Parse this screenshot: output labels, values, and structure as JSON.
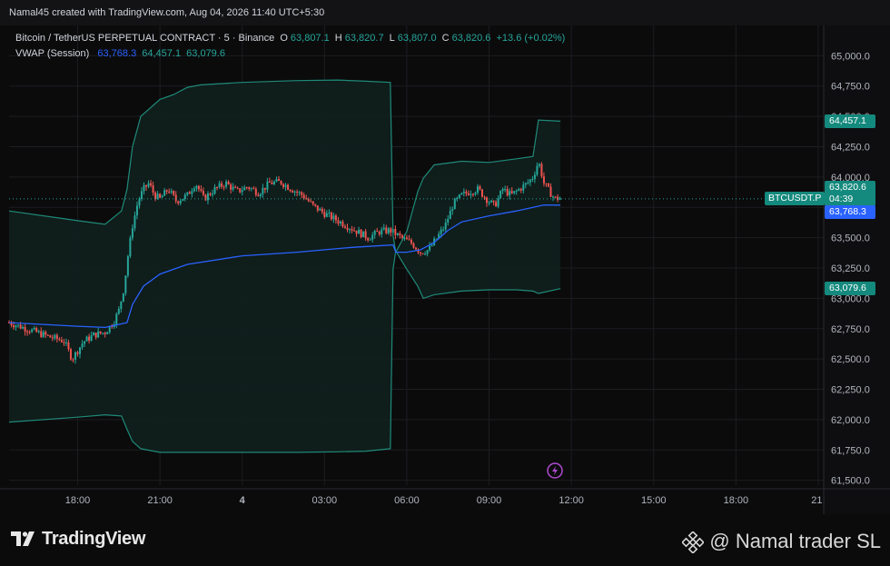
{
  "credit": "Namal45 created with TradingView.com, Aug 04, 2026 11:40 UTC+5:30",
  "legend": {
    "symbol": "Bitcoin / TetherUS PERPETUAL CONTRACT · 5 · Binance",
    "o_label": "O",
    "o_value": "63,807.1",
    "h_label": "H",
    "h_value": "63,820.7",
    "l_label": "L",
    "l_value": "63,807.0",
    "c_label": "C",
    "c_value": "63,820.6",
    "change": "+13.6 (+0.02%)",
    "vwap_label": "VWAP (Session)",
    "vwap_value": "63,768.3",
    "upper_value": "64,457.1",
    "lower_value": "63,079.6"
  },
  "tags": {
    "symbol": "BTCUSDT.P",
    "price": "63,820.6",
    "countdown": "04:39",
    "vwap": "63,768.3",
    "upper": "64,457.1",
    "lower": "63,079.6"
  },
  "colors": {
    "up": "#26a69a",
    "down": "#ef5350",
    "vwap": "#2962ff",
    "band": "#1f8a78",
    "band_fill": "#0f1f1d",
    "tag_green": "#14897d",
    "tag_blue": "#2962ff"
  },
  "branding": {
    "logo_text": "TradingView",
    "watermark": "@ Namal trader SL"
  },
  "chart_data": {
    "type": "line",
    "title": "Bitcoin / TetherUS PERPETUAL CONTRACT · 5 · Binance",
    "xlabel": "",
    "ylabel": "",
    "ylim": [
      61400,
      65100
    ],
    "grid": true,
    "y_ticks": [
      "61,500.0",
      "61,750.0",
      "62,000.0",
      "62,250.0",
      "62,500.0",
      "62,750.0",
      "63,000.0",
      "63,250.0",
      "63,500.0",
      "63,750.0",
      "64,000.0",
      "64,250.0",
      "64,500.0",
      "64,750.0",
      "65,000.0"
    ],
    "x_ticks": [
      "18:00",
      "21:00",
      "4",
      "03:00",
      "06:00",
      "09:00",
      "12:00",
      "15:00",
      "18:00",
      "21:"
    ],
    "x_tick_hours": [
      18,
      21,
      24,
      27,
      30,
      33,
      36,
      39,
      42,
      45
    ],
    "x_range_hours": [
      15.5,
      45.2
    ],
    "series": [
      {
        "name": "VWAP (Session)",
        "key": "vwap",
        "x": [
          15.5,
          18.0,
          19.0,
          19.8,
          20.0,
          20.4,
          21.0,
          22.0,
          24.0,
          26.0,
          28.0,
          29.5,
          29.6,
          30.0,
          30.5,
          31.0,
          31.5,
          32.0,
          33.0,
          34.0,
          35.0,
          35.6
        ],
        "y": [
          62800,
          62770,
          62760,
          62800,
          62950,
          63100,
          63200,
          63280,
          63350,
          63380,
          63420,
          63440,
          63380,
          63380,
          63400,
          63460,
          63560,
          63630,
          63680,
          63720,
          63770,
          63768
        ]
      },
      {
        "name": "Upper",
        "key": "upper",
        "x": [
          15.5,
          18.0,
          19.0,
          19.6,
          19.8,
          20.0,
          20.3,
          21.0,
          21.5,
          22.0,
          22.5,
          24.0,
          26.0,
          27.5,
          28.5,
          29.4,
          29.5,
          29.6,
          30.0,
          30.4,
          30.6,
          31.0,
          32.0,
          33.0,
          34.0,
          34.6,
          34.8,
          35.6
        ],
        "y": [
          63720,
          63640,
          63610,
          63720,
          63900,
          64250,
          64500,
          64640,
          64680,
          64740,
          64760,
          64780,
          64795,
          64800,
          64790,
          64780,
          63520,
          63380,
          63550,
          63880,
          63990,
          64100,
          64130,
          64120,
          64150,
          64170,
          64470,
          64460
        ]
      },
      {
        "name": "Lower",
        "key": "lower",
        "x": [
          15.5,
          18.0,
          19.0,
          19.6,
          19.8,
          20.0,
          20.3,
          21.0,
          21.5,
          22.0,
          22.5,
          24.0,
          26.0,
          27.5,
          28.5,
          29.4,
          29.5,
          29.6,
          30.0,
          30.4,
          30.6,
          31.0,
          32.0,
          33.0,
          34.0,
          34.6,
          34.8,
          35.6
        ],
        "y": [
          61980,
          62020,
          62040,
          62030,
          61920,
          61820,
          61760,
          61730,
          61730,
          61730,
          61730,
          61730,
          61730,
          61735,
          61740,
          61760,
          63240,
          63390,
          63240,
          63100,
          63000,
          63030,
          63060,
          63070,
          63070,
          63060,
          63040,
          63080
        ]
      },
      {
        "name": "Price",
        "key": "price",
        "x": [
          15.5,
          16.0,
          16.5,
          17.0,
          17.5,
          17.8,
          18.2,
          18.6,
          19.0,
          19.3,
          19.5,
          19.7,
          19.8,
          20.0,
          20.2,
          20.4,
          20.6,
          20.8,
          21.0,
          21.3,
          21.6,
          22.0,
          22.3,
          22.6,
          23.0,
          23.4,
          23.8,
          24.2,
          24.6,
          25.0,
          25.4,
          25.8,
          26.2,
          26.6,
          27.0,
          27.4,
          27.8,
          28.2,
          28.6,
          29.0,
          29.4,
          29.8,
          30.2,
          30.5,
          30.8,
          31.1,
          31.4,
          31.7,
          32.0,
          32.3,
          32.6,
          32.9,
          33.2,
          33.5,
          33.8,
          34.1,
          34.4,
          34.6,
          34.8,
          35.0,
          35.2,
          35.4,
          35.6
        ],
        "y": [
          62800,
          62760,
          62720,
          62680,
          62650,
          62500,
          62640,
          62700,
          62720,
          62800,
          62900,
          63100,
          63300,
          63600,
          63800,
          63900,
          63950,
          63850,
          63820,
          63900,
          63800,
          63850,
          63950,
          63820,
          63900,
          63950,
          63880,
          63920,
          63870,
          63950,
          63960,
          63900,
          63850,
          63760,
          63700,
          63650,
          63600,
          63550,
          63500,
          63550,
          63560,
          63500,
          63450,
          63380,
          63400,
          63500,
          63600,
          63780,
          63850,
          63880,
          63900,
          63820,
          63760,
          63900,
          63850,
          63900,
          63950,
          64000,
          64130,
          63950,
          63880,
          63820,
          63830
        ]
      }
    ]
  }
}
